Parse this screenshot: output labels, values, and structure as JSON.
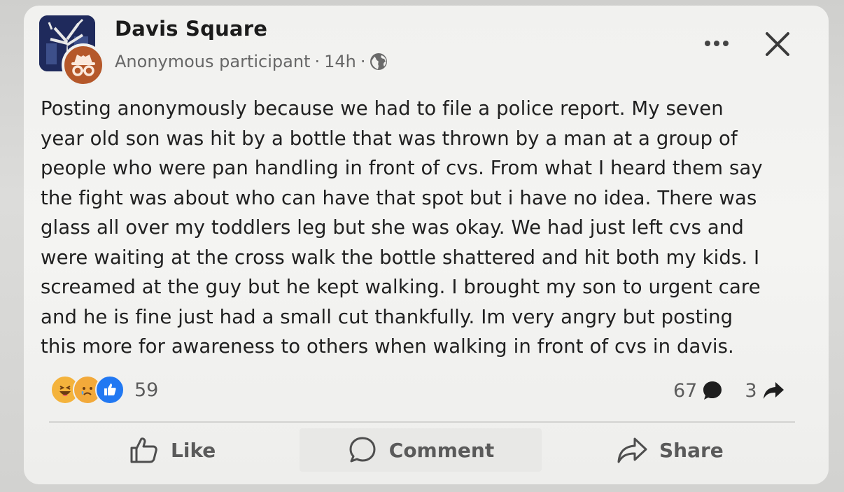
{
  "header": {
    "group_name": "Davis Square",
    "author": "Anonymous participant",
    "separator": "·",
    "time": "14h",
    "privacy_icon": "globe-icon"
  },
  "post": {
    "text": "Posting anonymously because we had to file a police report. My seven\nyear old son was hit by a bottle that was thrown by a man at a group of\npeople who were pan handling in front of cvs. From what I heard them say\nthe fight was about who can have that spot but i have no idea. There was\nglass all over my toddlers leg but she was okay. We had just left cvs and\nwere waiting at the cross walk the bottle shattered and hit both my kids. I\nscreamed at the guy but he kept walking. I brought my son to urgent care\nand he is fine just had a small cut thankfully. Im very angry but posting\nthis more for awareness to others when walking in front of cvs in davis."
  },
  "stats": {
    "reactions": [
      "haha-icon",
      "sad-icon",
      "like-icon"
    ],
    "reaction_count": "59",
    "comment_count": "67",
    "share_count": "3"
  },
  "actions": {
    "like": "Like",
    "comment": "Comment",
    "share": "Share"
  },
  "colors": {
    "like_blue": "#2178f2",
    "avatar_navy": "#1f2a5c",
    "anon_badge": "#b5582a"
  }
}
